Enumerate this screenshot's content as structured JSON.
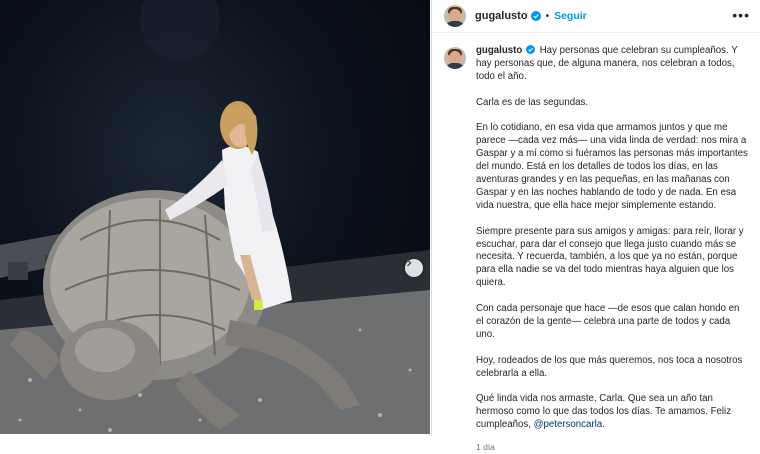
{
  "post": {
    "username": "gugalusto",
    "dot": "•",
    "follow_label": "Seguir",
    "more_label": "•••",
    "time": "1 día"
  },
  "caption": {
    "p1": "Hay personas que celebran su cumpleaños. Y hay personas que, de alguna manera, nos celebran a todos, todo el año.",
    "p2": "Carla es de las segundas.",
    "p3": "En lo cotidiano, en esa vida que armamos juntos y que me parece —cada vez más— una vida linda de verdad: nos mira a Gaspar y a mí como si fuéramos las personas más importantes del mundo. Está en los detalles de todos los días, en las aventuras grandes y en las pequeñas, en las mañanas con Gaspar y en las noches hablando de todo y de nada. En esa vida nuestra, que ella hace mejor simplemente estando.",
    "p4": "Siempre presente para sus amigos y amigas: para reír, llorar y escuchar, para dar el consejo que llega justo cuando más se necesita. Y recuerda, también, a los que ya no están, porque para ella nadie se va del todo mientras haya alguien que los quiera.",
    "p5": "Con cada personaje que hace —de esos que calan hondo en el corazón de la gente— celebra una parte de todos y cada uno.",
    "p6": "Hoy, rodeados de los que más queremos, nos toca a nosotros celebrarla a ella.",
    "p7": "Qué linda vida nos armaste, Carla. Que sea un año tan hermoso como lo que das todos los días. Te amamos. Feliz cumpleaños,",
    "mention": "@petersoncarla",
    "p7_end": "."
  },
  "icons": {
    "verified": "verified-badge-icon",
    "next": "chevron-right-icon"
  },
  "colors": {
    "link_blue": "#0095f6",
    "mention": "#00376b",
    "verified": "#0095f6"
  }
}
